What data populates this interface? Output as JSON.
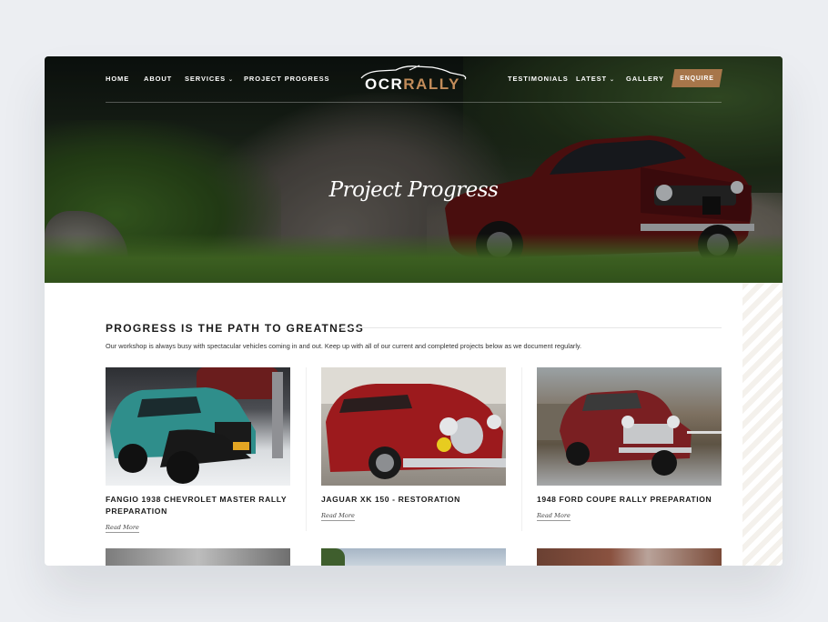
{
  "nav": {
    "left": [
      {
        "label": "HOME"
      },
      {
        "label": "ABOUT"
      },
      {
        "label": "SERVICES"
      },
      {
        "label": "PROJECT PROGRESS"
      }
    ],
    "right": [
      {
        "label": "TESTIMONIALS"
      },
      {
        "label": "LATEST"
      },
      {
        "label": "GALLERY"
      }
    ],
    "enquire": "ENQUIRE"
  },
  "logo": {
    "part1": "OCR",
    "part2": "RALLY"
  },
  "hero": {
    "title": "Project Progress"
  },
  "section": {
    "title": "PROGRESS IS THE PATH TO GREATNESS",
    "intro": "Our workshop is always busy with spectacular vehicles coming in and out. Keep up with all of our current and completed projects below as we document regularly."
  },
  "projects": [
    {
      "title": "FANGIO 1938 CHEVROLET MASTER RALLY PREPARATION",
      "link": "Read More"
    },
    {
      "title": "JAGUAR XK 150 - RESTORATION",
      "link": "Read More"
    },
    {
      "title": "1948 FORD COUPE RALLY PREPARATION",
      "link": "Read More"
    }
  ],
  "colors": {
    "accent": "#a7764a",
    "logo_accent": "#c28c5a"
  }
}
